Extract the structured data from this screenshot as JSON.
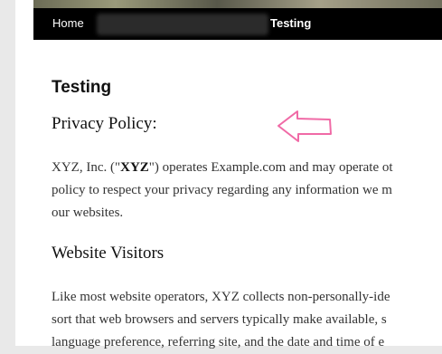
{
  "nav": {
    "home_label": "Home",
    "active_label": "Testing"
  },
  "page": {
    "title": "Testing"
  },
  "sections": {
    "privacy_heading": "Privacy Policy:",
    "privacy_line1_prefix": "XYZ, Inc. (\"",
    "privacy_line1_bold": "XYZ",
    "privacy_line1_suffix": "\") operates Example.com and may operate ot",
    "privacy_line2": "policy to respect your privacy regarding any information we m",
    "privacy_line3": "our websites.",
    "visitors_heading": "Website Visitors",
    "visitors_line1": "Like most website operators, XYZ collects non-personally-ide",
    "visitors_line2": "sort that web browsers and servers typically make available, s",
    "visitors_line3": "language preference, referring site, and the date and time of e"
  },
  "colors": {
    "navbar": "#000000",
    "annotation_arrow": "#f06aa6"
  },
  "icons": {
    "annotation": "left-arrow-icon"
  }
}
